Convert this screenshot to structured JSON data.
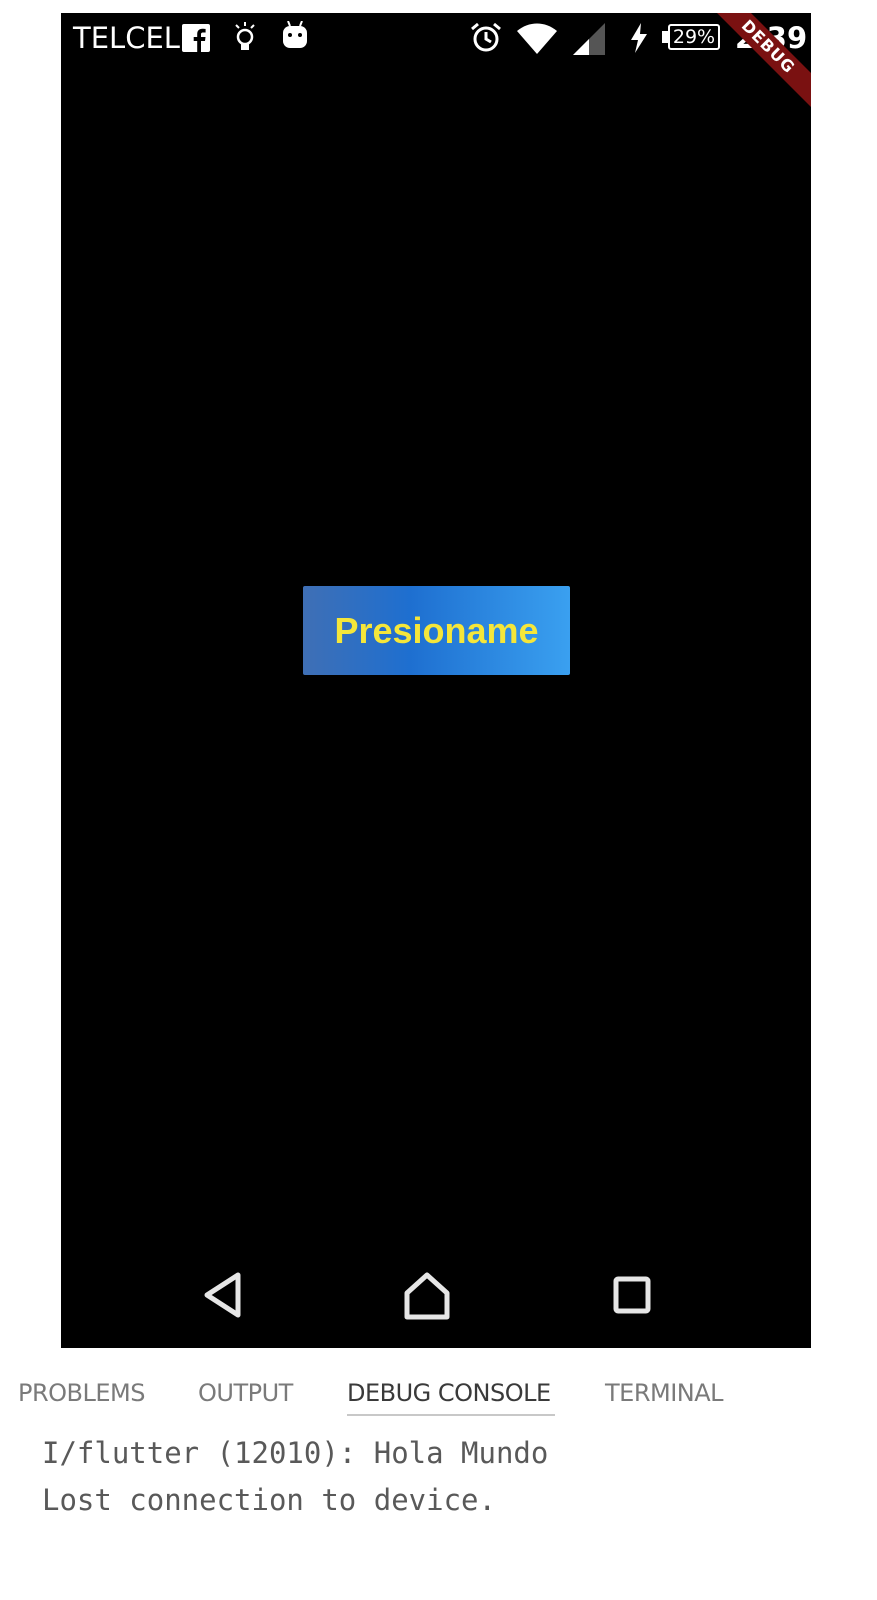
{
  "status_bar": {
    "carrier": "TELCEL",
    "battery": "29%",
    "time": "2:39",
    "icons": [
      "facebook-icon",
      "lightbulb-icon",
      "android-icon",
      "alarm-icon",
      "wifi-icon",
      "signal-icon",
      "charging-bolt-icon",
      "battery-icon"
    ]
  },
  "debug_banner": "DEBUG",
  "main": {
    "button_label": "Presioname",
    "button_text_color": "#f5e63a",
    "button_gradient": [
      "#3f6fb5",
      "#1e6fd0",
      "#3aa0f0"
    ]
  },
  "nav_bar": {
    "icons": [
      "back-icon",
      "home-icon",
      "recents-icon"
    ]
  },
  "panel": {
    "tabs": [
      {
        "label": "PROBLEMS"
      },
      {
        "label": "OUTPUT"
      },
      {
        "label": "DEBUG CONSOLE",
        "active": true
      },
      {
        "label": "TERMINAL"
      }
    ]
  },
  "console": {
    "lines": [
      "I/flutter (12010): Hola Mundo",
      "Lost connection to device."
    ]
  }
}
